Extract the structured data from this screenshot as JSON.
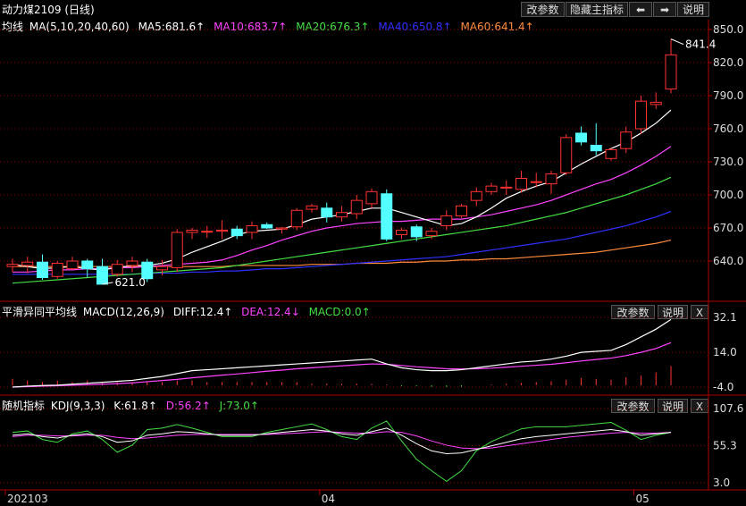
{
  "window": {
    "title": "动力煤2109 (日线)",
    "buttons": {
      "params": "改参数",
      "hide_main": "隐藏主指标",
      "prev": "⬅",
      "next": "➡",
      "help": "说明"
    }
  },
  "main_panel": {
    "header": {
      "label": "均线",
      "ma_def": "MA(5,10,20,40,60)",
      "ma5": "MA5:681.6↑",
      "ma10": "MA10:683.7↑",
      "ma20": "MA20:676.3↑",
      "ma40": "MA40:650.8↑",
      "ma60": "MA60:641.4↑"
    },
    "price_ticks": [
      "850.0",
      "820.0",
      "790.0",
      "760.0",
      "730.0",
      "700.0",
      "670.0",
      "640.0"
    ],
    "high_label": "841.4",
    "low_label": "621.0"
  },
  "macd_panel": {
    "header": {
      "label": "平滑异同平均线",
      "def": "MACD(12,26,9)",
      "diff": "DIFF:12.4↑",
      "dea": "DEA:12.4↓",
      "macd": "MACD:0.0↑"
    },
    "ticks": [
      "32.1",
      "14.0",
      "-4.0"
    ],
    "buttons": {
      "params": "改参数",
      "help": "说明",
      "close": "X"
    }
  },
  "kdj_panel": {
    "header": {
      "label": "随机指标",
      "def": "KDJ(9,3,3)",
      "k": "K:61.8↑",
      "d": "D:56.2↑",
      "j": "J:73.0↑"
    },
    "ticks": [
      "107.6",
      "55.3",
      "3.0"
    ],
    "buttons": {
      "params": "改参数",
      "help": "说明",
      "close": "X"
    }
  },
  "date_axis": {
    "labels": [
      "202103",
      "04",
      "05"
    ]
  },
  "colors": {
    "up": "#ff3232",
    "down": "#54ffff",
    "ma5": "#ffffff",
    "ma10": "#ff44ff",
    "ma20": "#44dd44",
    "ma40": "#3030ff",
    "ma60": "#ff8c3c",
    "grid": "#8b0000"
  },
  "chart_data": {
    "type": "candlestick",
    "dates_label_positions": {
      "202103": 0,
      "04": 21,
      "05": 42
    },
    "candles": [
      {
        "o": 635,
        "h": 642,
        "c": 637,
        "l": 630
      },
      {
        "o": 636,
        "h": 644,
        "c": 639,
        "l": 629
      },
      {
        "o": 639,
        "h": 646,
        "c": 625,
        "l": 623
      },
      {
        "o": 626,
        "h": 640,
        "c": 638,
        "l": 624
      },
      {
        "o": 633,
        "h": 644,
        "c": 640,
        "l": 632
      },
      {
        "o": 640,
        "h": 642,
        "c": 633,
        "l": 625
      },
      {
        "o": 635,
        "h": 642,
        "c": 619,
        "l": 621
      },
      {
        "o": 628,
        "h": 641,
        "c": 637,
        "l": 626
      },
      {
        "o": 636,
        "h": 644,
        "c": 640,
        "l": 630
      },
      {
        "o": 639,
        "h": 642,
        "c": 624,
        "l": 621
      },
      {
        "o": 632,
        "h": 641,
        "c": 635,
        "l": 627
      },
      {
        "o": 634,
        "h": 669,
        "c": 666,
        "l": 630
      },
      {
        "o": 666,
        "h": 670,
        "c": 668,
        "l": 660
      },
      {
        "o": 667,
        "h": 672,
        "c": 667,
        "l": 661
      },
      {
        "o": 667,
        "h": 677,
        "c": 668,
        "l": 660
      },
      {
        "o": 669,
        "h": 672,
        "c": 663,
        "l": 660
      },
      {
        "o": 666,
        "h": 676,
        "c": 672,
        "l": 660
      },
      {
        "o": 673,
        "h": 675,
        "c": 670,
        "l": 669
      },
      {
        "o": 669,
        "h": 671,
        "c": 670,
        "l": 665
      },
      {
        "o": 671,
        "h": 688,
        "c": 686,
        "l": 668
      },
      {
        "o": 687,
        "h": 692,
        "c": 690,
        "l": 684
      },
      {
        "o": 688,
        "h": 693,
        "c": 680,
        "l": 675
      },
      {
        "o": 680,
        "h": 690,
        "c": 684,
        "l": 676
      },
      {
        "o": 683,
        "h": 700,
        "c": 695,
        "l": 678
      },
      {
        "o": 692,
        "h": 706,
        "c": 703,
        "l": 688
      },
      {
        "o": 701,
        "h": 705,
        "c": 660,
        "l": 658
      },
      {
        "o": 664,
        "h": 670,
        "c": 668,
        "l": 660
      },
      {
        "o": 671,
        "h": 673,
        "c": 662,
        "l": 658
      },
      {
        "o": 663,
        "h": 670,
        "c": 667,
        "l": 660
      },
      {
        "o": 672,
        "h": 686,
        "c": 681,
        "l": 668
      },
      {
        "o": 681,
        "h": 692,
        "c": 690,
        "l": 679
      },
      {
        "o": 695,
        "h": 707,
        "c": 703,
        "l": 690
      },
      {
        "o": 703,
        "h": 711,
        "c": 708,
        "l": 700
      },
      {
        "o": 707,
        "h": 713,
        "c": 707,
        "l": 700
      },
      {
        "o": 705,
        "h": 722,
        "c": 715,
        "l": 702
      },
      {
        "o": 712,
        "h": 720,
        "c": 712,
        "l": 707
      },
      {
        "o": 710,
        "h": 722,
        "c": 719,
        "l": 701
      },
      {
        "o": 720,
        "h": 755,
        "c": 752,
        "l": 718
      },
      {
        "o": 756,
        "h": 762,
        "c": 748,
        "l": 745
      },
      {
        "o": 745,
        "h": 765,
        "c": 740,
        "l": 736
      },
      {
        "o": 733,
        "h": 743,
        "c": 741,
        "l": 731
      },
      {
        "o": 742,
        "h": 762,
        "c": 757,
        "l": 738
      },
      {
        "o": 760,
        "h": 790,
        "c": 785,
        "l": 755
      },
      {
        "o": 782,
        "h": 793,
        "c": 784,
        "l": 778
      },
      {
        "o": 796,
        "h": 841.4,
        "c": 827,
        "l": 792
      }
    ],
    "ma5": [
      637,
      635,
      633,
      634,
      635,
      633,
      632,
      634,
      636,
      636,
      638,
      642,
      648,
      653,
      658,
      664,
      667,
      668,
      669,
      673,
      678,
      680,
      682,
      685,
      688,
      688,
      684,
      680,
      676,
      672,
      674,
      680,
      688,
      697,
      703,
      708,
      712,
      720,
      728,
      735,
      742,
      748,
      756,
      765,
      777
    ],
    "ma10": [
      630,
      630,
      631,
      632,
      632,
      633,
      633,
      634,
      634,
      635,
      636,
      637,
      638,
      639,
      641,
      645,
      650,
      654,
      659,
      663,
      667,
      670,
      672,
      674,
      675,
      676,
      676,
      677,
      678,
      678,
      678,
      680,
      682,
      685,
      688,
      691,
      695,
      700,
      705,
      710,
      714,
      720,
      727,
      735,
      744
    ],
    "ma20": [
      620,
      621,
      622,
      623,
      624,
      625,
      626,
      627,
      628,
      629,
      630,
      631,
      632,
      633,
      634,
      636,
      638,
      640,
      642,
      644,
      646,
      648,
      650,
      652,
      654,
      656,
      658,
      660,
      662,
      664,
      666,
      668,
      670,
      672,
      675,
      678,
      681,
      684,
      688,
      692,
      696,
      700,
      705,
      710,
      716
    ],
    "ma40": [
      628,
      628,
      628,
      628,
      628,
      628,
      628,
      628,
      628,
      629,
      629,
      629,
      630,
      630,
      631,
      631,
      632,
      633,
      633,
      634,
      635,
      636,
      637,
      638,
      639,
      640,
      641,
      642,
      643,
      644,
      646,
      648,
      650,
      652,
      654,
      656,
      658,
      660,
      663,
      666,
      669,
      672,
      676,
      680,
      685
    ],
    "ma60": [
      635,
      635,
      635,
      635,
      635,
      635,
      635,
      635,
      635,
      635,
      635,
      635,
      635,
      635,
      635,
      636,
      636,
      636,
      636,
      636,
      637,
      637,
      637,
      638,
      638,
      638,
      639,
      639,
      640,
      640,
      641,
      641,
      642,
      642,
      643,
      644,
      645,
      646,
      647,
      648,
      650,
      652,
      654,
      656,
      659
    ],
    "macd": {
      "diff": [
        -4.0,
        -3.5,
        -3.2,
        -3.0,
        -2.5,
        -2.0,
        -1.5,
        -1.0,
        -0.5,
        0.5,
        1.5,
        3.0,
        4.5,
        5.0,
        5.5,
        6.0,
        6.5,
        7.0,
        7.5,
        8.0,
        8.5,
        9.0,
        9.5,
        10.0,
        10.5,
        8.0,
        6.0,
        5.0,
        4.5,
        4.5,
        5.0,
        6.0,
        7.0,
        8.0,
        9.0,
        9.5,
        10.5,
        12.0,
        14.0,
        14.5,
        15.0,
        18.0,
        22.0,
        26.0,
        31.0
      ],
      "dea": [
        -4.0,
        -3.8,
        -3.5,
        -3.3,
        -3.0,
        -2.8,
        -2.5,
        -2.2,
        -1.8,
        -1.2,
        -0.6,
        0.0,
        0.8,
        1.5,
        2.2,
        2.8,
        3.5,
        4.2,
        4.8,
        5.5,
        6.0,
        6.5,
        7.0,
        7.5,
        8.0,
        7.8,
        7.2,
        6.5,
        6.0,
        5.5,
        5.4,
        5.5,
        5.8,
        6.3,
        6.8,
        7.3,
        7.8,
        8.6,
        9.5,
        10.3,
        11.0,
        12.3,
        14.0,
        16.0,
        19.0
      ],
      "hist": [
        4,
        3,
        2,
        3,
        2,
        3,
        2,
        2,
        2,
        2,
        2,
        3,
        3,
        2,
        2,
        2,
        2,
        2,
        2,
        2,
        1,
        1,
        1,
        1,
        1,
        0.5,
        -0.5,
        -0.5,
        -1,
        -1,
        -0.8,
        0,
        0.5,
        1,
        1.5,
        2,
        2.5,
        3.5,
        4.5,
        4,
        3.5,
        5,
        6,
        8,
        12
      ]
    },
    "kdj": {
      "k": [
        70,
        72,
        68,
        66,
        70,
        72,
        68,
        60,
        62,
        70,
        72,
        75,
        74,
        72,
        70,
        70,
        70,
        72,
        74,
        76,
        78,
        76,
        72,
        70,
        75,
        80,
        70,
        58,
        48,
        44,
        45,
        50,
        55,
        60,
        65,
        68,
        70,
        72,
        74,
        76,
        78,
        75,
        70,
        72,
        74
      ],
      "d": [
        68,
        70,
        70,
        69,
        69,
        70,
        70,
        67,
        65,
        66,
        68,
        70,
        71,
        71,
        71,
        71,
        71,
        71,
        72,
        73,
        74,
        75,
        74,
        73,
        73,
        75,
        74,
        69,
        62,
        56,
        52,
        51,
        52,
        55,
        58,
        61,
        64,
        67,
        69,
        71,
        73,
        74,
        73,
        73,
        74
      ],
      "j": [
        74,
        76,
        64,
        60,
        72,
        76,
        64,
        46,
        56,
        78,
        80,
        85,
        80,
        74,
        68,
        68,
        68,
        74,
        78,
        82,
        86,
        78,
        68,
        64,
        80,
        90,
        62,
        36,
        20,
        5,
        20,
        48,
        61,
        70,
        79,
        82,
        82,
        82,
        84,
        86,
        88,
        77,
        64,
        70,
        74
      ]
    }
  }
}
